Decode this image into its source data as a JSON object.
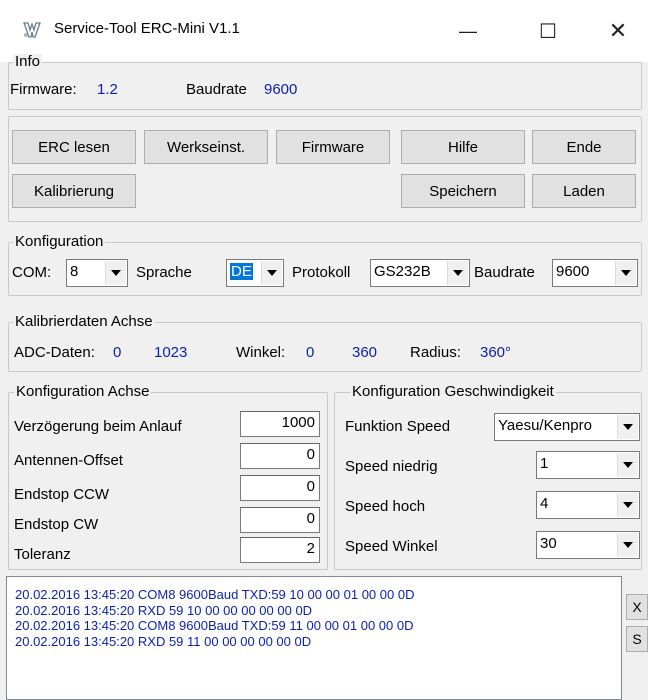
{
  "window": {
    "title": "Service-Tool ERC-Mini V1.1",
    "controls": [
      "—",
      "☐",
      "✕"
    ]
  },
  "info": {
    "legend": "Info",
    "firmware_label": "Firmware:",
    "firmware_value": "1.2",
    "baud_label": "Baudrate",
    "baud_value": "9600"
  },
  "buttons": {
    "erc_lesen": "ERC lesen",
    "werkseinst": "Werkseinst.",
    "firmware": "Firmware",
    "hilfe": "Hilfe",
    "ende": "Ende",
    "kalibrierung": "Kalibrierung",
    "speichern": "Speichern",
    "laden": "Laden"
  },
  "konfiguration": {
    "legend": "Konfiguration",
    "com_label": "COM:",
    "com_value": "8",
    "sprache_label": "Sprache",
    "sprache_value": "DE",
    "protokoll_label": "Protokoll",
    "protokoll_value": "GS232B",
    "baud_label": "Baudrate",
    "baud_value": "9600"
  },
  "kalib": {
    "legend": "Kalibrierdaten Achse",
    "adc_label": "ADC-Daten:",
    "adc_min": "0",
    "adc_max": "1023",
    "winkel_label": "Winkel:",
    "winkel_min": "0",
    "winkel_max": "360",
    "radius_label": "Radius:",
    "radius_value": "360°"
  },
  "achse": {
    "legend": "Konfiguration Achse",
    "rows": [
      {
        "label": "Verzögerung beim Anlauf",
        "value": "1000"
      },
      {
        "label": "Antennen-Offset",
        "value": "0"
      },
      {
        "label": "Endstop CCW",
        "value": "0"
      },
      {
        "label": "Endstop CW",
        "value": "0"
      },
      {
        "label": "Toleranz",
        "value": "2"
      }
    ]
  },
  "speed": {
    "legend": "Konfiguration Geschwindigkeit",
    "funktion_label": "Funktion Speed",
    "funktion_value": "Yaesu/Kenpro",
    "niedrig_label": "Speed niedrig",
    "niedrig_value": "1",
    "hoch_label": "Speed hoch",
    "hoch_value": "4",
    "winkel_label": "Speed Winkel",
    "winkel_value": "30"
  },
  "log": {
    "lines": [
      "20.02.2016 13:45:20 COM8 9600Baud TXD:59 10 00 00 01 00 00 0D",
      "20.02.2016 13:45:20 RXD 59 10 00 00 00 00 00 0D",
      "20.02.2016 13:45:20 COM8 9600Baud TXD:59 11 00 00 01 00 00 0D",
      "20.02.2016 13:45:20 RXD 59 11 00 00 00 00 00 0D"
    ],
    "side_buttons": [
      "X",
      "S"
    ]
  },
  "colors": {
    "value_blue": "#0b1fb3",
    "selection": "#0078d7"
  }
}
